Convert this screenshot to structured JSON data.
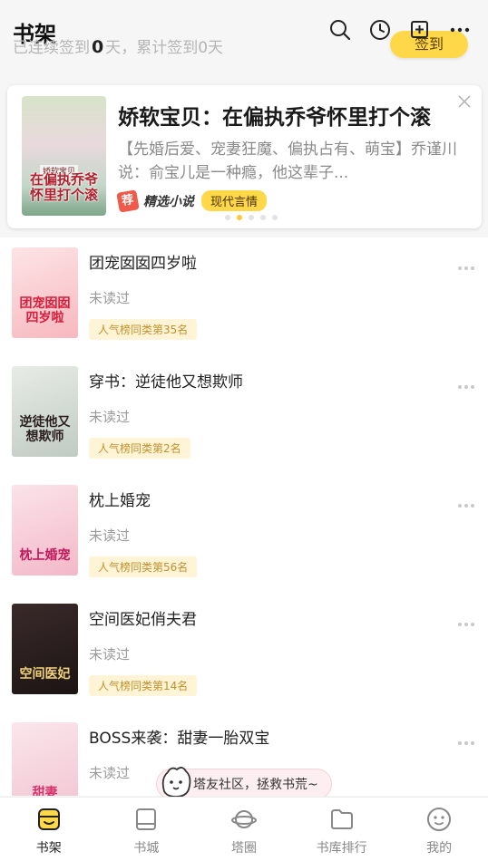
{
  "header": {
    "title": "书架",
    "signin_prefix": "已连续签到",
    "signin_days": "0",
    "signin_suffix": "天，累计签到0天",
    "signin_button": "签到",
    "icons": [
      "search-icon",
      "history-icon",
      "add-icon",
      "more-icon"
    ]
  },
  "banner": {
    "title": "娇软宝贝：在偏执乔爷怀里打个滚",
    "description": "【先婚后爱、宠妻狂魔、偏执占有、萌宝】乔谨川说：俞宝儿是一种瘾，他这辈子...",
    "cover_title": "在偏执乔爷怀里打个滚",
    "cover_top": "娇软宝贝",
    "brand_logo": "荐",
    "brand": "精选小说",
    "genre": "现代言情",
    "page_count": 5,
    "active_page": 2
  },
  "books": [
    {
      "title": "团宠囡囡四岁啦",
      "status": "未读过",
      "rank": "人气榜同类第35名",
      "cover_text": "团宠囡囡四岁啦",
      "cover_colors": [
        "#fde4e6",
        "#f7b8be"
      ],
      "cover_text_color": "#d81e3c"
    },
    {
      "title": "穿书：逆徒他又想欺师",
      "status": "未读过",
      "rank": "人气榜同类第2名",
      "cover_text": "逆徒他又想欺师",
      "cover_colors": [
        "#e8ece6",
        "#bfcbc3"
      ],
      "cover_text_color": "#2a1d1d"
    },
    {
      "title": "枕上婚宠",
      "status": "未读过",
      "rank": "人气榜同类第56名",
      "cover_text": "枕上婚宠",
      "cover_colors": [
        "#fbe3ea",
        "#f3b8c8"
      ],
      "cover_text_color": "#c2185b"
    },
    {
      "title": "空间医妃俏夫君",
      "status": "未读过",
      "rank": "人气榜同类第14名",
      "cover_text": "空间医妃",
      "cover_colors": [
        "#3a2a2a",
        "#1c1414"
      ],
      "cover_text_color": "#f2d27a"
    },
    {
      "title": "BOSS来袭：甜妻一胎双宝",
      "status": "未读过",
      "rank": "",
      "cover_text": "甜妻",
      "cover_colors": [
        "#fbe6ec",
        "#f1c4d2"
      ],
      "cover_text_color": "#d6336c"
    }
  ],
  "community_bubble": "塔友社区，拯救书荒~",
  "nav": [
    {
      "label": "书架",
      "icon": "bookshelf-icon",
      "active": true
    },
    {
      "label": "书城",
      "icon": "book-icon",
      "active": false
    },
    {
      "label": "塔圈",
      "icon": "planet-icon",
      "active": false
    },
    {
      "label": "书库排行",
      "icon": "folder-icon",
      "active": false
    },
    {
      "label": "我的",
      "icon": "profile-icon",
      "active": false
    }
  ],
  "colors": {
    "accent": "#ffd84a",
    "rank_text": "#c2902c",
    "rank_bg": "#fff4d6"
  }
}
